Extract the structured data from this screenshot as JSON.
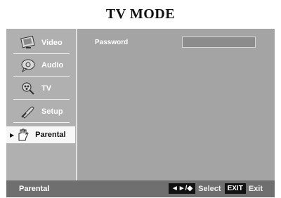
{
  "title": "TV MODE",
  "sidebar": {
    "items": [
      {
        "label": "Video",
        "icon": "monitor-icon"
      },
      {
        "label": "Audio",
        "icon": "speech-bubble-icon"
      },
      {
        "label": "TV",
        "icon": "magnifier-icon"
      },
      {
        "label": "Setup",
        "icon": "wrench-icon"
      },
      {
        "label": "Parental",
        "icon": "hand-icon",
        "selected": true
      }
    ]
  },
  "content": {
    "password_label": "Password",
    "password_value": ""
  },
  "footer": {
    "selected_label": "Parental",
    "nav_keys": "◄►/◆",
    "select_label": "Select",
    "exit_key": "EXIT",
    "exit_label": "Exit"
  }
}
